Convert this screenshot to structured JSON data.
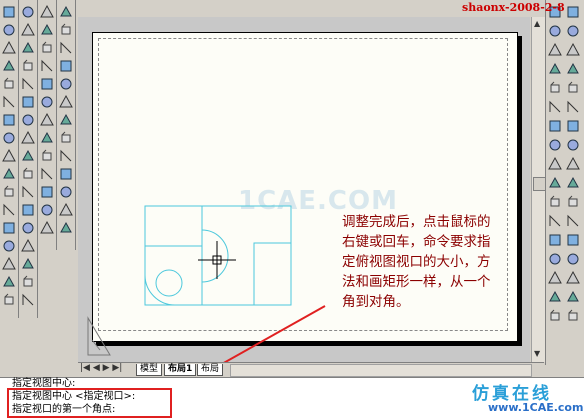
{
  "watermark": "shaonx-2008-2-8",
  "annotation": "调整完成后，点击鼠标的右键或回车，命令要求指定俯视图视口的大小，方法和画矩形一样，从一个角到对角。",
  "canvas_watermark": "1CAE.COM",
  "tabs": [
    {
      "label": "模型"
    },
    {
      "label": "布局1"
    },
    {
      "label": "布局"
    }
  ],
  "command_lines": [
    "指定视图中心:",
    "指定视图中心 <指定视口>:",
    "指定视口的第一个角点:"
  ],
  "brand": {
    "name": "仿真在线",
    "url": "www.1CAE.com"
  },
  "colors": {
    "drawing": "#4cc8dc",
    "annotation": "#8b0000",
    "highlight": "#e02020"
  }
}
